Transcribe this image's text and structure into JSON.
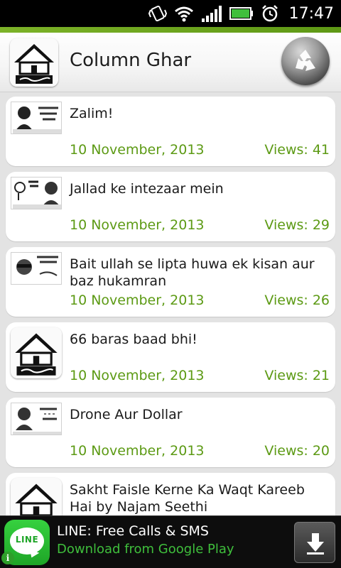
{
  "status_bar": {
    "time": "17:47",
    "icons": [
      "vibrate-icon",
      "wifi-icon",
      "signal-icon",
      "battery-icon",
      "alarm-icon"
    ]
  },
  "header": {
    "app_logo_icon": "column-ghar-logo-icon",
    "title": "Column Ghar",
    "refresh_icon": "recycle-icon",
    "accent_color": "#6aa81d"
  },
  "columns": [
    {
      "title": "Zalim!",
      "date": "10 November, 2013",
      "views": "Views: 41",
      "thumb": "columnist-thumbnail"
    },
    {
      "title": "Jallad ke intezaar mein",
      "date": "10 November, 2013",
      "views": "Views: 29",
      "thumb": "columnist-thumbnail"
    },
    {
      "title": "Bait ullah se lipta huwa ek kisan aur baz hukamran",
      "date": "10 November, 2013",
      "views": "Views: 26",
      "thumb": "columnist-thumbnail"
    },
    {
      "title": "66 baras baad bhi!",
      "date": "10 November, 2013",
      "views": "Views: 21",
      "thumb": "column-ghar-logo-icon"
    },
    {
      "title": "Drone Aur Dollar",
      "date": "10 November, 2013",
      "views": "Views: 20",
      "thumb": "columnist-thumbnail"
    },
    {
      "title": "Sakht Faisle Kerne Ka Waqt Kareeb Hai by Najam Seethi",
      "date": "",
      "views": "",
      "thumb": "column-ghar-logo-icon"
    }
  ],
  "ad": {
    "app_icon_label": "LINE",
    "title": "LINE: Free Calls & SMS",
    "subtitle": "Download from Google Play",
    "download_icon": "download-arrow-icon",
    "info_icon": "info-icon"
  },
  "colors": {
    "date_views_text": "#5c9a14",
    "ad_subtitle": "#3fbf3c",
    "background": "#e3e3e3"
  }
}
